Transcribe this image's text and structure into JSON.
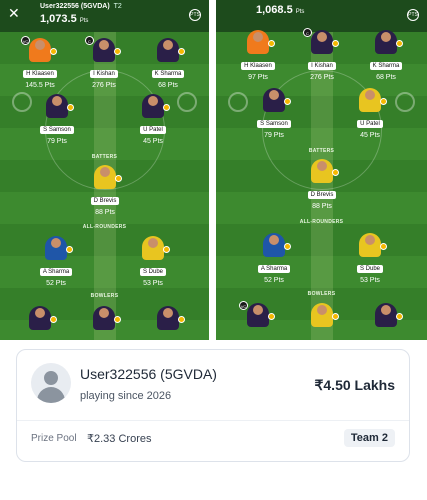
{
  "left_panel": {
    "user": "User322556 (5GVDA)",
    "team_tag": "T2",
    "points": "1,073.5",
    "points_unit": "Pts",
    "sections": {
      "batters": "BATTERS",
      "allrounders": "ALL-ROUNDERS",
      "bowlers": "BOWLERS"
    },
    "players": [
      {
        "name": "H Klaasen",
        "pts": "145.5 Pts",
        "cap": "VC"
      },
      {
        "name": "I Kishan",
        "pts": "276 Pts",
        "cap": "C"
      },
      {
        "name": "K Sharma",
        "pts": "68 Pts"
      },
      {
        "name": "S Samson",
        "pts": "79 Pts"
      },
      {
        "name": "U Patel",
        "pts": "45 Pts"
      },
      {
        "name": "D Brevis",
        "pts": "88 Pts"
      },
      {
        "name": "A Sharma",
        "pts": "52 Pts"
      },
      {
        "name": "S Dube",
        "pts": "53 Pts"
      }
    ]
  },
  "right_panel": {
    "points": "1,068.5",
    "points_unit": "Pts",
    "sections": {
      "batters": "BATTERS",
      "allrounders": "ALL-ROUNDERS",
      "bowlers": "BOWLERS"
    },
    "players": [
      {
        "name": "H Klaasen",
        "pts": "97 Pts"
      },
      {
        "name": "I Kishan",
        "pts": "276 Pts",
        "cap": "C"
      },
      {
        "name": "K Sharma",
        "pts": "68 Pts"
      },
      {
        "name": "S Samson",
        "pts": "79 Pts"
      },
      {
        "name": "U Patel",
        "pts": "45 Pts"
      },
      {
        "name": "D Brevis",
        "pts": "88 Pts"
      },
      {
        "name": "A Sharma",
        "pts": "52 Pts"
      },
      {
        "name": "S Dube",
        "pts": "53 Pts"
      }
    ],
    "bowler_cap": "VC"
  },
  "pts_badge": "PTS",
  "close_icon": "close-icon",
  "card": {
    "username": "User322556 (5GVDA)",
    "since": "playing since 2026",
    "amount": "₹4.50 Lakhs",
    "prize_pool_label": "Prize Pool",
    "prize_pool_value": "₹2.33 Crores",
    "team": "Team 2"
  }
}
